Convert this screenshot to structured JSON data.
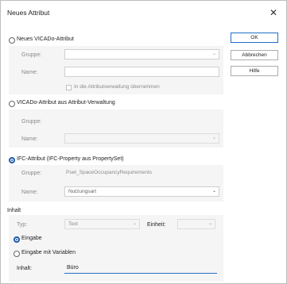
{
  "window": {
    "title": "Neues Attribut",
    "close_icon": "close-icon"
  },
  "buttons": {
    "ok": "OK",
    "cancel": "Abbrechen",
    "help": "Hilfe"
  },
  "option_new": {
    "label": "Neues VICADo-Attribut",
    "group_label": "Gruppe:",
    "group_value": "",
    "name_label": "Name:",
    "checkbox_label": "In die Attributverwaltung übernehmen"
  },
  "option_existing": {
    "label": "VICADo-Attribut aus Attribut-Verwaltung",
    "group_label": "Gruppe:",
    "name_label": "Name:",
    "name_value": ""
  },
  "option_ifc": {
    "label": "IFC-Attribut (IFC-Property aus PropertySet)",
    "group_label": "Gruppe:",
    "group_value": "Pset_SpaceOccupancyRequirements",
    "name_label": "Name:",
    "name_value": "Nutzungsart"
  },
  "content": {
    "section_label": "Inhalt",
    "type_label": "Typ:",
    "type_value": "Text",
    "unit_label": "Einheit:",
    "unit_value": "",
    "radio_input": "Eingabe",
    "radio_vars": "Eingabe mit Variablen",
    "value_label": "Inhalt:",
    "value": "Büro"
  }
}
